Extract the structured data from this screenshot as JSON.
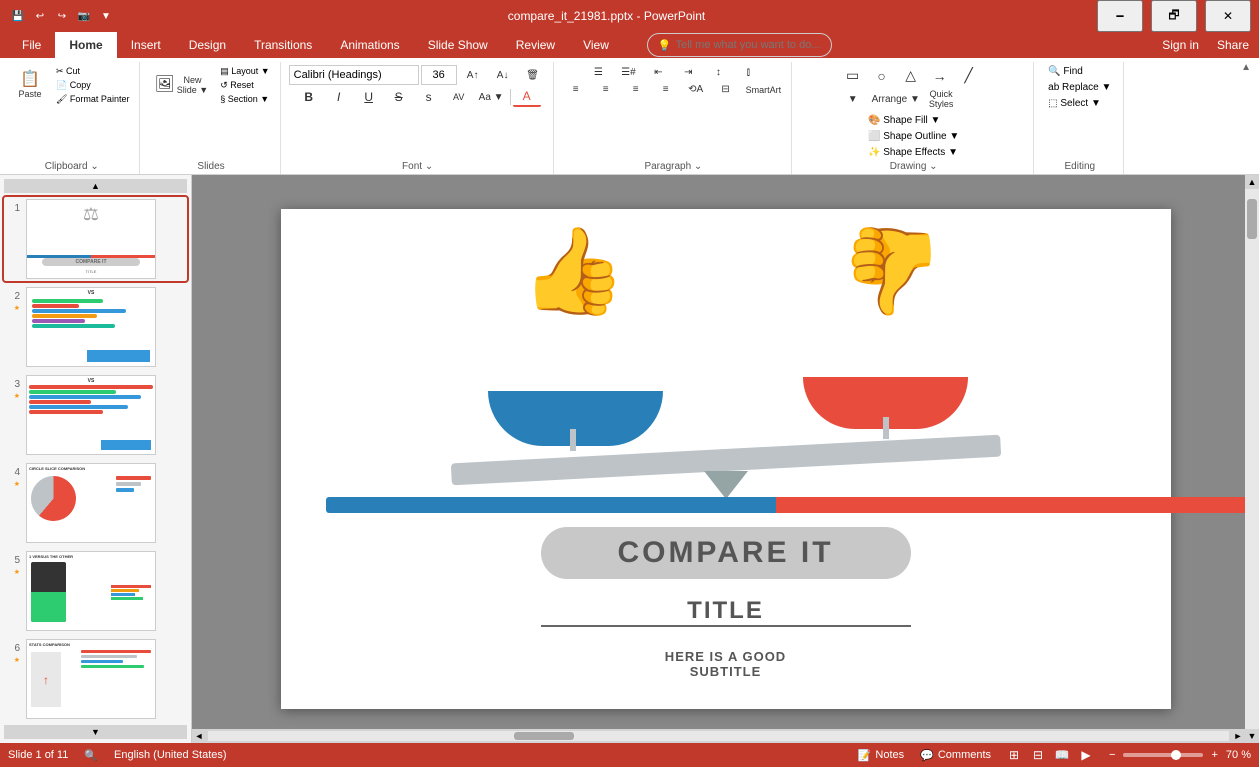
{
  "titlebar": {
    "title": "compare_it_21981.pptx - PowerPoint",
    "minimize": "🗕",
    "restore": "🗗",
    "close": "✕",
    "qat": [
      "💾",
      "↩",
      "↪",
      "📷",
      "▼"
    ]
  },
  "ribbon": {
    "tabs": [
      "File",
      "Home",
      "Insert",
      "Design",
      "Transitions",
      "Animations",
      "Slide Show",
      "Review",
      "View"
    ],
    "active_tab": "Home",
    "tell_me": "Tell me what you want to do...",
    "sign_in": "Sign in",
    "share": "Share",
    "groups": {
      "clipboard": {
        "label": "Clipboard",
        "paste": "Paste",
        "cut": "Cut",
        "copy": "Copy",
        "format_painter": "Format Painter"
      },
      "slides": {
        "label": "Slides",
        "new_slide": "New Slide",
        "layout": "Layout",
        "reset": "Reset",
        "section": "Section"
      },
      "font": {
        "label": "Font",
        "font_name": "Calibri (Headings)",
        "font_size": "36",
        "bold": "B",
        "italic": "I",
        "underline": "U",
        "strikethrough": "S",
        "shadow": "A",
        "character_spacing": "AV",
        "change_case": "Aa",
        "font_color": "A",
        "increase_size": "A↑",
        "decrease_size": "A↓",
        "clear_format": "🗑"
      },
      "paragraph": {
        "label": "Paragraph",
        "bullets": "☰",
        "numbering": "☰#",
        "decrease_indent": "←",
        "increase_indent": "→",
        "line_spacing": "↕",
        "columns": "|||",
        "align_left": "≡",
        "align_center": "≡",
        "align_right": "≡",
        "justify": "≡",
        "text_direction": "↕A",
        "align_text": "⊟",
        "smart_art": "SmartArt"
      },
      "drawing": {
        "label": "Drawing",
        "arrange": "Arrange",
        "quick_styles": "Quick Styles",
        "shape_fill": "Shape Fill",
        "shape_outline": "Shape Outline",
        "shape_effects": "Shape Effects"
      },
      "editing": {
        "label": "Editing",
        "find": "Find",
        "replace": "Replace",
        "select": "Select"
      }
    }
  },
  "slides": [
    {
      "number": "1",
      "starred": false,
      "active": true,
      "label": "Compare It slide"
    },
    {
      "number": "2",
      "starred": true,
      "label": "VS comparison bars"
    },
    {
      "number": "3",
      "starred": true,
      "label": "VS comparison detail"
    },
    {
      "number": "4",
      "starred": true,
      "label": "Circle slice comparison"
    },
    {
      "number": "5",
      "starred": true,
      "label": "1 vs the other"
    },
    {
      "number": "6",
      "starred": true,
      "label": "Stats comparison"
    }
  ],
  "slide_content": {
    "compare_it": "COMPARE IT",
    "title": "TITLE",
    "subtitle_line1": "HERE IS A GOOD",
    "subtitle_line2": "SUBTITLE"
  },
  "statusbar": {
    "slide_info": "Slide 1 of 11",
    "language": "English (United States)",
    "notes": "Notes",
    "comments": "Comments",
    "zoom": "70 %",
    "zoom_value": 70
  }
}
